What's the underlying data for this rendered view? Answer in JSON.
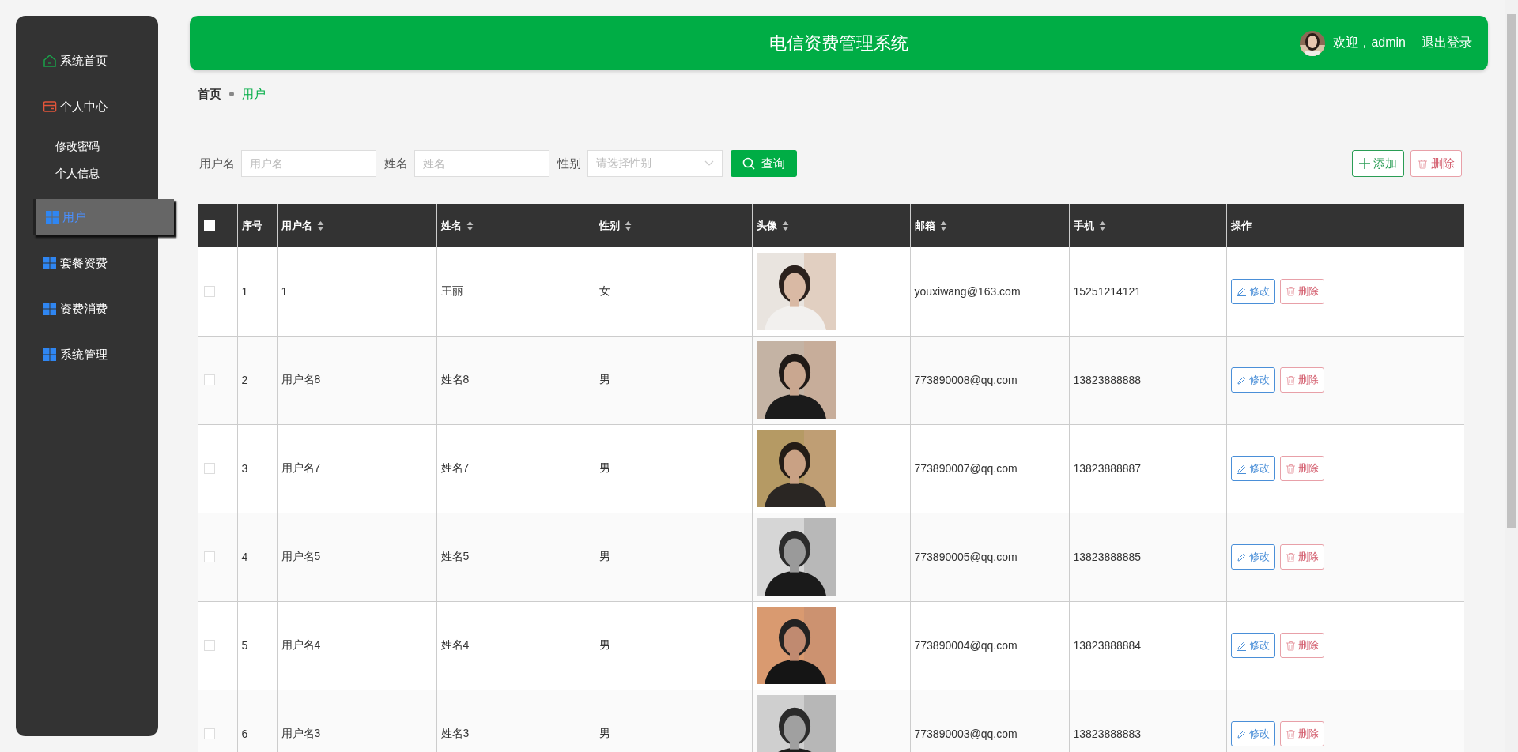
{
  "sidebar": {
    "items": [
      {
        "label": "系统首页",
        "selected": false
      },
      {
        "label": "个人中心",
        "selected": false,
        "children": [
          {
            "label": "修改密码"
          },
          {
            "label": "个人信息"
          }
        ]
      },
      {
        "label": "用户",
        "selected": true
      },
      {
        "label": "套餐资费",
        "selected": false
      },
      {
        "label": "资费消费",
        "selected": false
      },
      {
        "label": "系统管理",
        "selected": false
      }
    ]
  },
  "header": {
    "title": "电信资费管理系统",
    "welcome": "欢迎，admin",
    "logout": "退出登录"
  },
  "breadcrumb": [
    "首页",
    "用户"
  ],
  "search": {
    "fields": [
      {
        "kind": "input",
        "label": "用户名",
        "placeholder": "用户名"
      },
      {
        "kind": "input",
        "label": "姓名",
        "placeholder": "姓名"
      },
      {
        "kind": "select",
        "label": "性别",
        "placeholder": "请选择性别"
      }
    ],
    "button": "查询"
  },
  "toolbar": {
    "add": "添加",
    "delete": "删除"
  },
  "table": {
    "header_checked": false,
    "columns": [
      {
        "label": "序号",
        "sortable": false
      },
      {
        "label": "用户名",
        "sortable": true
      },
      {
        "label": "姓名",
        "sortable": true
      },
      {
        "label": "性别",
        "sortable": true
      },
      {
        "label": "头像",
        "sortable": true
      },
      {
        "label": "邮箱",
        "sortable": true
      },
      {
        "label": "手机",
        "sortable": true
      },
      {
        "label": "操作",
        "sortable": false
      }
    ],
    "rows": [
      {
        "checked": false,
        "cells": [
          "1",
          "1",
          "王丽",
          "女",
          {
            "kind": "picture"
          },
          "youxiwang@163.com",
          "15251214121"
        ],
        "actions": [
          "修改",
          "删除"
        ]
      },
      {
        "checked": false,
        "cells": [
          "2",
          "用户名8",
          "姓名8",
          "男",
          {
            "kind": "picture"
          },
          "773890008@qq.com",
          "13823888888"
        ],
        "actions": [
          "修改",
          "删除"
        ]
      },
      {
        "checked": false,
        "cells": [
          "3",
          "用户名7",
          "姓名7",
          "男",
          {
            "kind": "picture"
          },
          "773890007@qq.com",
          "13823888887"
        ],
        "actions": [
          "修改",
          "删除"
        ]
      },
      {
        "checked": false,
        "cells": [
          "4",
          "用户名5",
          "姓名5",
          "男",
          {
            "kind": "picture"
          },
          "773890005@qq.com",
          "13823888885"
        ],
        "actions": [
          "修改",
          "删除"
        ]
      },
      {
        "checked": false,
        "cells": [
          "5",
          "用户名4",
          "姓名4",
          "男",
          {
            "kind": "picture"
          },
          "773890004@qq.com",
          "13823888884"
        ],
        "actions": [
          "修改",
          "删除"
        ]
      },
      {
        "checked": false,
        "cells": [
          "6",
          "用户名3",
          "姓名3",
          "男",
          {
            "kind": "picture"
          },
          "773890003@qq.com",
          "13823888883"
        ],
        "actions": [
          "修改",
          "删除"
        ]
      }
    ]
  }
}
